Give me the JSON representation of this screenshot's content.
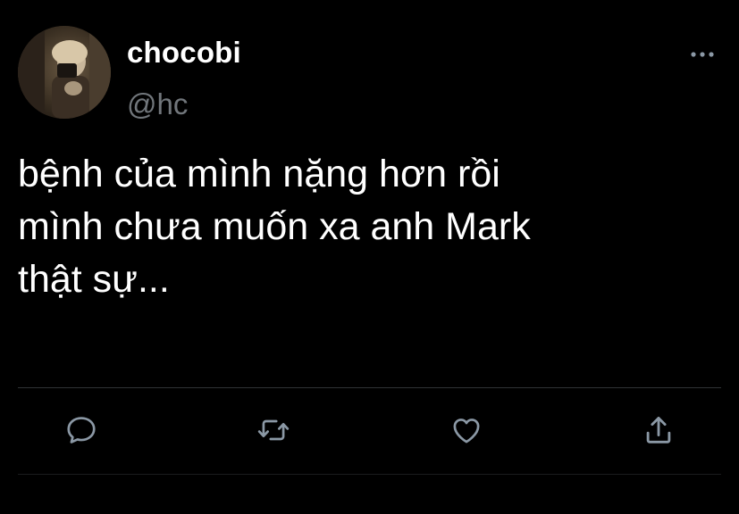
{
  "user": {
    "display_name": "chocobi",
    "handle": "@hc",
    "avatar_icon": "profile-photo"
  },
  "tweet": {
    "lines": [
      "bệnh của mình nặng hơn rồi",
      "mình chưa muốn xa anh Mark",
      "thật sự..."
    ]
  },
  "actions": {
    "reply_icon": "reply-icon",
    "retweet_icon": "retweet-icon",
    "like_icon": "like-icon",
    "share_icon": "share-icon",
    "more_icon": "more-icon"
  },
  "colors": {
    "background": "#000000",
    "text": "#ffffff",
    "secondary": "#71767b",
    "divider": "#2f3336"
  }
}
